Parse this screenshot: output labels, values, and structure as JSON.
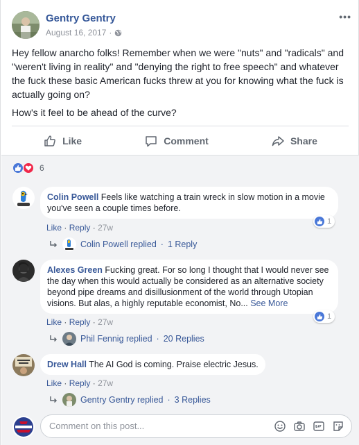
{
  "post": {
    "author": "Gentry Gentry",
    "date": "August 16, 2017",
    "date_separator": "·",
    "more_label": "•••",
    "body_paragraph_1": "Hey fellow anarcho folks! Remember when we were \"nuts\" and \"radicals\" and \"weren't living in reality\" and \"denying the right to free speech\" and whatever the fuck these basic American fucks threw at you for knowing what the fuck is actually going on?",
    "body_paragraph_2": "How's it feel to be ahead of the curve?"
  },
  "actions": {
    "like": "Like",
    "comment": "Comment",
    "share": "Share"
  },
  "reactions": {
    "count": "6",
    "types": [
      "like-icon",
      "love-icon"
    ]
  },
  "comments": [
    {
      "author": "Colin Powell",
      "text": "Feels like watching a train wreck in slow motion in a movie you've seen a couple times before.",
      "like_label": "Like",
      "reply_label": "Reply",
      "time": "27w",
      "reaction_count": "1",
      "reply_summary_name": "Colin Powell replied",
      "reply_summary_count": "1 Reply"
    },
    {
      "author": "Alexes Green",
      "text": "Fucking great. For so long I thought that I would never see the day when this would actually be considered as an alternative society beyond pipe dreams and disillusionment of the world through Utopian visions. But alas, a highly reputable economist, No...",
      "see_more": "See More",
      "like_label": "Like",
      "reply_label": "Reply",
      "time": "27w",
      "reaction_count": "1",
      "reply_summary_name": "Phil Fennig replied",
      "reply_summary_count": "20 Replies"
    },
    {
      "author": "Drew Hall",
      "text": "The AI God is coming. Praise electric Jesus.",
      "like_label": "Like",
      "reply_label": "Reply",
      "time": "27w",
      "reply_summary_name": "Gentry Gentry replied",
      "reply_summary_count": "3 Replies"
    }
  ],
  "composer": {
    "placeholder": "Comment on this post...",
    "icons": [
      "emoji-icon",
      "camera-icon",
      "gif-icon",
      "sticker-icon"
    ]
  },
  "colors": {
    "link_blue": "#385898",
    "meta_gray": "#90949c",
    "comment_bg": "#f2f3f5",
    "like_blue": "#4a78d8",
    "love_red": "#f0284a"
  }
}
